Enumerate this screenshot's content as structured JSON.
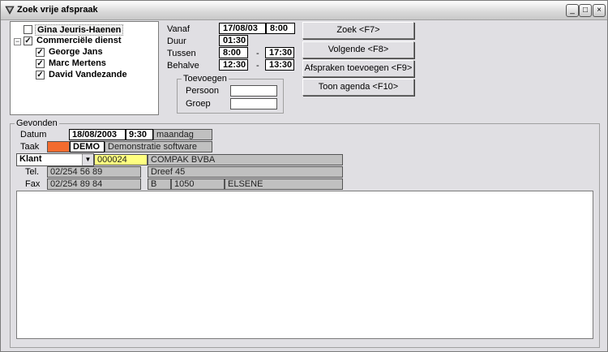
{
  "window": {
    "title": "Zoek vrije afspraak",
    "controls": {
      "minimize": "_",
      "maximize": "□",
      "close": "×"
    }
  },
  "tree": [
    {
      "label": "Gina Jeuris-Haenen",
      "checked": false,
      "indent": 0,
      "selected": true
    },
    {
      "label": "Commerciële dienst",
      "checked": true,
      "indent": 0,
      "expander": "−"
    },
    {
      "label": "George Jans",
      "checked": true,
      "indent": 1
    },
    {
      "label": "Marc Mertens",
      "checked": true,
      "indent": 1
    },
    {
      "label": "David Vandezande",
      "checked": true,
      "indent": 1
    }
  ],
  "search": {
    "vanaf": {
      "label": "Vanaf",
      "date": "17/08/03",
      "time": "8:00"
    },
    "duur": {
      "label": "Duur",
      "value": "01:30"
    },
    "tussen": {
      "label": "Tussen",
      "from": "8:00",
      "sep": "-",
      "to": "17:30"
    },
    "behalve": {
      "label": "Behalve",
      "from": "12:30",
      "sep": "-",
      "to": "13:30"
    }
  },
  "toevoegen": {
    "title": "Toevoegen",
    "persoon_label": "Persoon",
    "persoon_value": "",
    "groep_label": "Groep",
    "groep_value": ""
  },
  "buttons": {
    "zoek": "Zoek <F7>",
    "volgende": "Volgende <F8>",
    "afspraken_toevoegen": "Afspraken toevoegen <F9>",
    "toon_agenda": "Toon agenda <F10>"
  },
  "gevonden": {
    "title": "Gevonden",
    "datum_label": "Datum",
    "datum": "18/08/2003",
    "tijd": "9:30",
    "dag": "maandag",
    "taak_label": "Taak",
    "taak_color": "#f26b2e",
    "taak_code": "DEMO",
    "taak_desc": "Demonstratie software",
    "klant_select": "Klant",
    "klant_code": "000024",
    "klant_naam": "COMPAK BVBA",
    "tel_label": "Tel.",
    "tel": "02/254 56 89",
    "adres": "Dreef 45",
    "fax_label": "Fax",
    "fax": "02/254 89 84",
    "land": "B",
    "postcode": "1050",
    "gemeente": "ELSENE",
    "notes": ""
  }
}
